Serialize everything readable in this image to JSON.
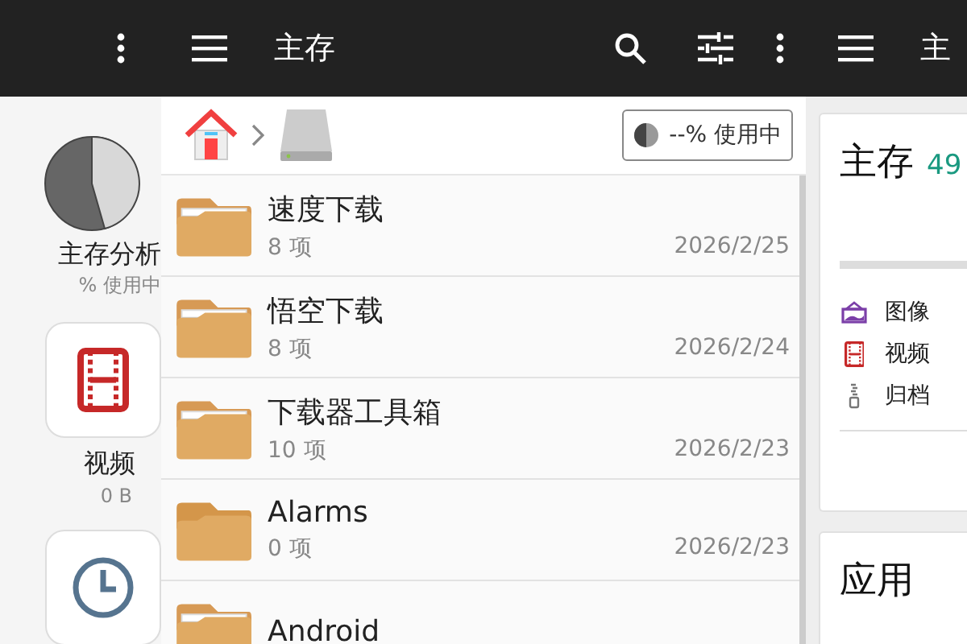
{
  "left_pane": {
    "storage": {
      "title": "主存分析",
      "usage": "% 使用中"
    },
    "tiles": [
      {
        "kind": "video",
        "label": "视频",
        "size": "0 B"
      },
      {
        "kind": "recent"
      }
    ]
  },
  "main_pane": {
    "toolbar": {
      "title": "主存"
    },
    "breadcrumb": {
      "usage": "--% 使用中"
    },
    "rows": [
      {
        "name": "速度下载",
        "count": "8 项",
        "date": "2026/2/25",
        "empty": false
      },
      {
        "name": "悟空下载",
        "count": "8 项",
        "date": "2026/2/24",
        "empty": false
      },
      {
        "name": "下载器工具箱",
        "count": "10 项",
        "date": "2026/2/23",
        "empty": false
      },
      {
        "name": "Alarms",
        "count": "0 项",
        "date": "2026/2/23",
        "empty": true
      },
      {
        "name": "Android",
        "empty": false
      }
    ]
  },
  "right_pane": {
    "toolbar": {
      "title": "主"
    },
    "storage_card": {
      "title": "主存",
      "amount": "49"
    },
    "categories": [
      {
        "kind": "image",
        "label": "图像"
      },
      {
        "kind": "video",
        "label": "视频"
      },
      {
        "kind": "archive",
        "label": "归档"
      }
    ],
    "apps_card": {
      "title": "应用"
    }
  }
}
